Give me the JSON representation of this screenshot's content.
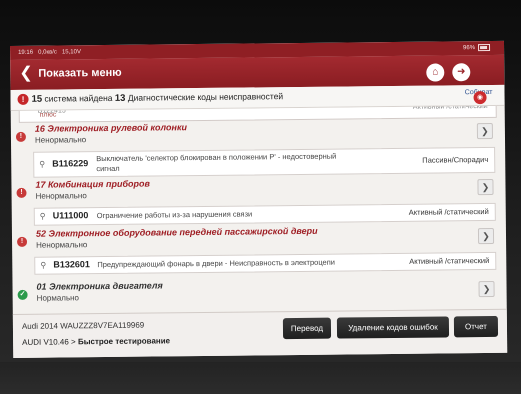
{
  "status_bar": {
    "time": "19:16",
    "net": "0,0кв/с",
    "voltage": "15,10V",
    "battery": "96%"
  },
  "header": {
    "title": "Показать меню"
  },
  "summary": {
    "count": "15",
    "text1": "система найдена",
    "dtc_count": "13",
    "text2": "Диагностические коды неисправностей",
    "collect": "Собират"
  },
  "partial_row": {
    "code": "B122415",
    "desc": "плюс",
    "state": "Активный /статический"
  },
  "systems": [
    {
      "name": "16 Электроника рулевой колонки",
      "status": "Ненормально",
      "dtc": {
        "code": "B116229",
        "desc_line1": "Выключатель 'селектор блокирован в положении P' - недостоверный",
        "desc_line2": "сигнал",
        "state": "Пассивн/Спорадич"
      }
    },
    {
      "name": "17 Комбинация приборов",
      "status": "Ненормально",
      "dtc": {
        "code": "U111000",
        "desc_line1": "Ограничение работы из-за нарушения связи",
        "state": "Активный /статический"
      }
    },
    {
      "name": "52 Электронное оборудование передней пассажирской двери",
      "status": "Ненормально",
      "dtc": {
        "code": "B132601",
        "desc_line1": "Предупреждающий фонарь в двери - Неисправность в электроцепи",
        "state": "Активный /статический"
      }
    },
    {
      "name": "01 Электроника двигателя",
      "status": "Нормально"
    }
  ],
  "footer": {
    "vehicle": "Audi  2014  WAUZZZ8V7EA119969",
    "version_prefix": "AUDI V10.46 >",
    "mode": "Быстрое тестирование",
    "buttons": {
      "translate": "Перевод",
      "clear": "Удаление кодов ошибок",
      "report": "Отчет"
    }
  }
}
